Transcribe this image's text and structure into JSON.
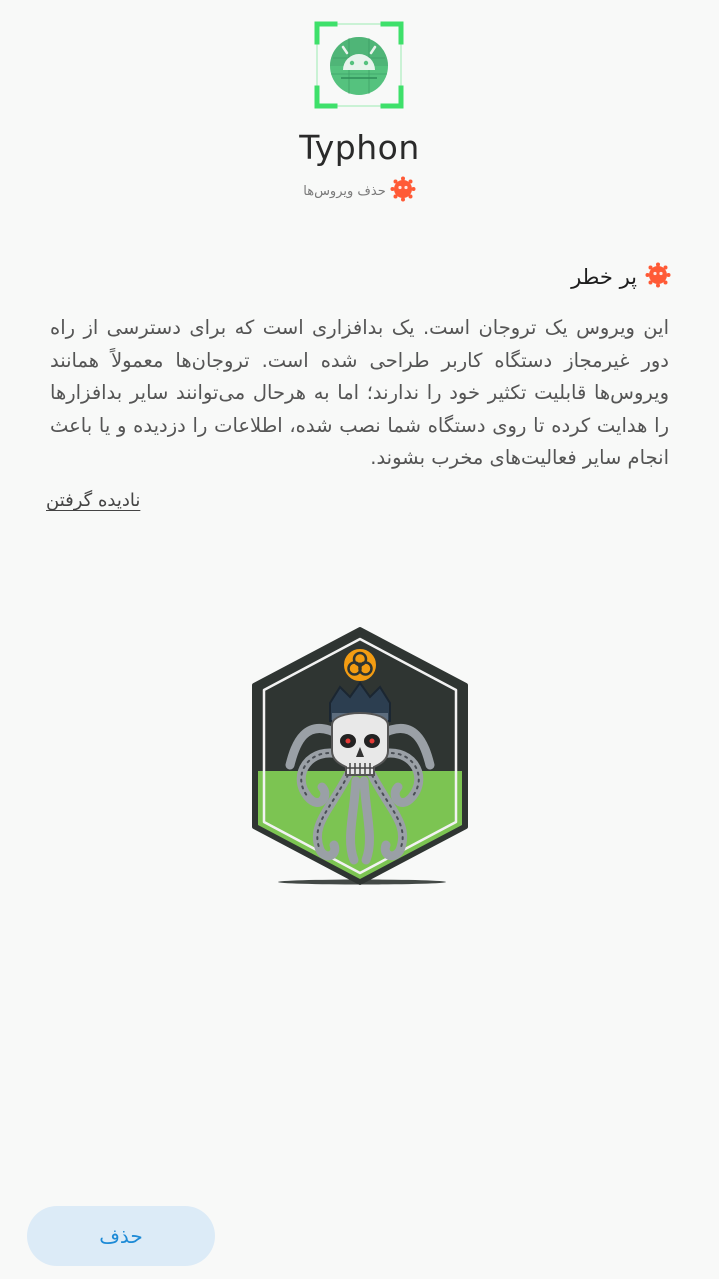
{
  "app": {
    "name": "Typhon",
    "category_label": "حذف ویروس‌ها"
  },
  "threat": {
    "level_label": "پر خطر",
    "description": "این ویروس یک تروجان است. یک بدافزاری است که برای دسترسی از راه دور غیرمجاز دستگاه کاربر طراحی شده است. تروجان‌ها معمولاً همانند ویروس‌ها قابلیت تکثیر خود را ندارند؛ اما به هرحال می‌توانند سایر بدافزارها را هدایت کرده تا روی دستگاه شما نصب شده، اطلاعات را دزدیده و یا باعث انجام سایر فعالیت‌های مخرب بشوند.",
    "ignore_label": "نادیده گرفتن"
  },
  "actions": {
    "delete_label": "حذف"
  },
  "icons": {
    "app_icon": "android-scan-icon",
    "category_icon": "virus-icon",
    "threat_icon": "virus-icon",
    "illustration": "octopus-skull-biohazard-badge"
  },
  "colors": {
    "accent_blue": "#1d8ad6",
    "button_bg": "#dcebf7",
    "virus_orange": "#ff5a36",
    "scan_green": "#3ee06a",
    "badge_green": "#7cc452",
    "badge_dark": "#2f3532"
  }
}
